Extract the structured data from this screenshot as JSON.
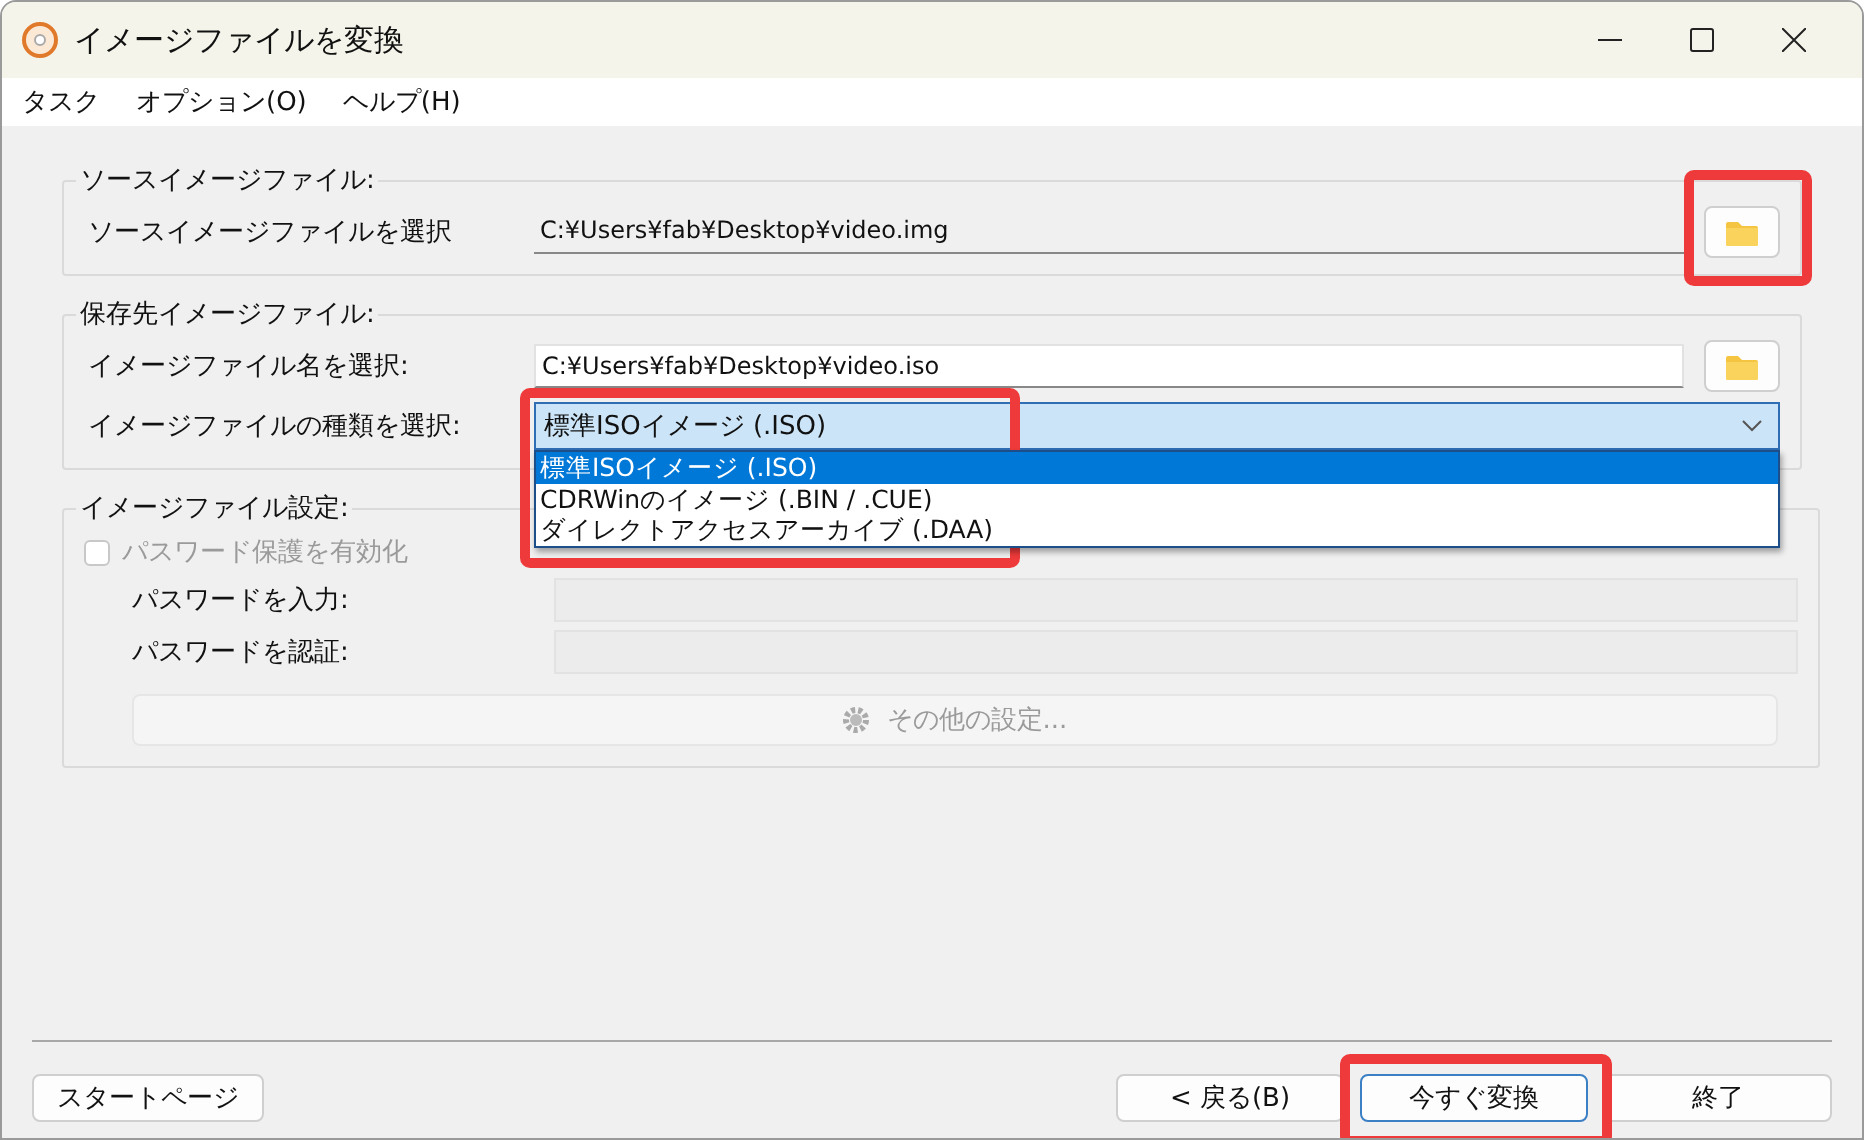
{
  "window": {
    "title": "イメージファイルを変換"
  },
  "menu": [
    {
      "label": "タスク"
    },
    {
      "label": "オプション(O)"
    },
    {
      "label": "ヘルプ(H)"
    }
  ],
  "source": {
    "title": "ソースイメージファイル:",
    "label": "ソースイメージファイルを選択",
    "value": "C:¥Users¥fab¥Desktop¥video.img",
    "browse_highlighted": true
  },
  "destination": {
    "title": "保存先イメージファイル:",
    "name_label": "イメージファイル名を選択:",
    "name_value": "C:¥Users¥fab¥Desktop¥video.iso",
    "type_label": "イメージファイルの種類を選択:",
    "type_value": "標準ISOイメージ (.ISO)",
    "expanded": true,
    "highlighted": true,
    "options": [
      {
        "label": "標準ISOイメージ (.ISO)",
        "selected": true
      },
      {
        "label": "CDRWinのイメージ (.BIN / .CUE)",
        "selected": false
      },
      {
        "label": "ダイレクトアクセスアーカイブ (.DAA)",
        "selected": false
      }
    ]
  },
  "settings": {
    "title": "イメージファイル設定:",
    "disabled": true,
    "protect": {
      "label": "パスワード保護を有効化",
      "checked": false
    },
    "password_label": "パスワードを入力:",
    "confirm_label": "パスワードを認証:",
    "more_button": "その他の設定..."
  },
  "footer": {
    "start": "スタートページ",
    "back": "< 戻る(B)",
    "convert": "今すぐ変換",
    "convert_highlighted": true,
    "exit": "終了"
  }
}
